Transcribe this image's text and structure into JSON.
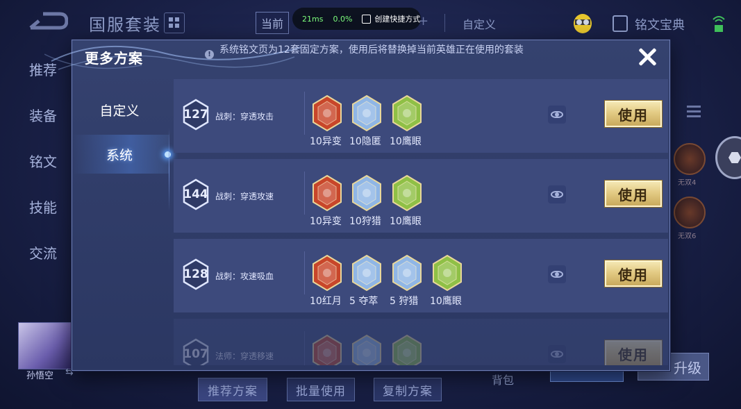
{
  "background": {
    "page_title": "国服套装",
    "tab_current": "当前",
    "tab_custom": "自定义",
    "codex_label": "铭文宝典",
    "perf": {
      "latency": "21ms",
      "loss": "0.0%",
      "shortcut": "创建快捷方式"
    },
    "left_nav": [
      "推荐",
      "装备",
      "铭文",
      "技能",
      "交流"
    ],
    "hero_name": "孙悟空",
    "bottom_buttons": [
      "推荐方案",
      "批量使用",
      "复制方案"
    ],
    "bag_label": "背包",
    "upgrade_label": "升级",
    "right_runes": [
      "无双4",
      "无双6"
    ]
  },
  "modal": {
    "title": "更多方案",
    "description": "系统铭文页为12套固定方案，使用后将替换掉当前英雄正在使用的套装",
    "tabs": [
      "自定义",
      "系统"
    ],
    "active_tab": "系统",
    "use_label": "使用",
    "schemes": [
      {
        "number": "127",
        "name": "战刺：穿透攻击",
        "runes": [
          {
            "label": "10异变",
            "icon": "yibian-rune-icon",
            "color": "#c8462a"
          },
          {
            "label": "10隐匿",
            "icon": "yinni-rune-icon",
            "color": "#8fb6e6"
          },
          {
            "label": "10鹰眼",
            "icon": "yingyan-rune-icon",
            "color": "#8fc046"
          }
        ]
      },
      {
        "number": "144",
        "name": "战刺：穿透攻速",
        "runes": [
          {
            "label": "10异变",
            "icon": "yibian-rune-icon",
            "color": "#c8462a"
          },
          {
            "label": "10狩猎",
            "icon": "shoulie-rune-icon",
            "color": "#8fb6e6"
          },
          {
            "label": "10鹰眼",
            "icon": "yingyan-rune-icon",
            "color": "#8fc046"
          }
        ]
      },
      {
        "number": "128",
        "name": "战刺：攻速吸血",
        "runes": [
          {
            "label": "10红月",
            "icon": "hongyue-rune-icon",
            "color": "#c8462a"
          },
          {
            "label": "5 夺萃",
            "icon": "duocui-rune-icon",
            "color": "#8fb6e6"
          },
          {
            "label": "5 狩猎",
            "icon": "shoulie-rune-icon",
            "color": "#8fb6e6"
          },
          {
            "label": "10鹰眼",
            "icon": "yingyan-rune-icon",
            "color": "#8fc046"
          }
        ]
      },
      {
        "number": "107",
        "name": "法师：穿透移速",
        "runes": [
          {
            "label": "",
            "icon": "red-rune-icon",
            "color": "#c8462a"
          },
          {
            "label": "",
            "icon": "blue-rune-icon",
            "color": "#8fb6e6"
          },
          {
            "label": "",
            "icon": "green-rune-icon",
            "color": "#8fc046"
          }
        ]
      }
    ]
  }
}
